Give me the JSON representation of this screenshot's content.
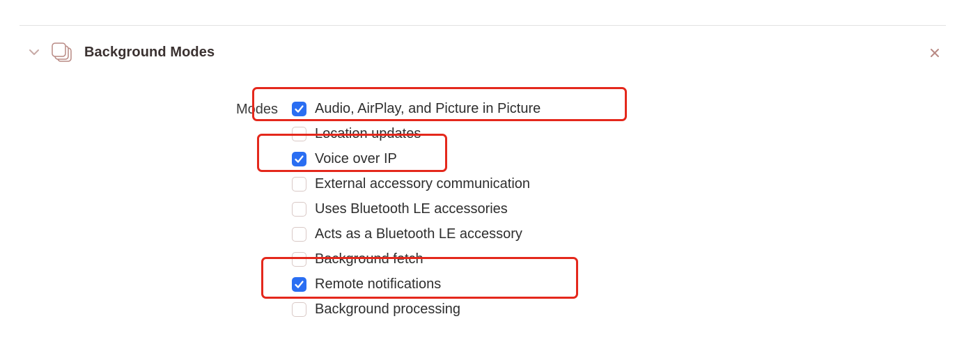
{
  "section": {
    "title": "Background Modes",
    "chevron_icon": "chevron-down-icon",
    "capability_icon": "background-modes-icon",
    "close_icon": "close-icon"
  },
  "modes": {
    "label": "Modes",
    "items": [
      {
        "label": "Audio, AirPlay, and Picture in Picture",
        "checked": true
      },
      {
        "label": "Location updates",
        "checked": false
      },
      {
        "label": "Voice over IP",
        "checked": true
      },
      {
        "label": "External accessory communication",
        "checked": false
      },
      {
        "label": "Uses Bluetooth LE accessories",
        "checked": false
      },
      {
        "label": "Acts as a Bluetooth LE accessory",
        "checked": false
      },
      {
        "label": "Background fetch",
        "checked": false
      },
      {
        "label": "Remote notifications",
        "checked": true
      },
      {
        "label": "Background processing",
        "checked": false
      }
    ]
  },
  "colors": {
    "checkbox_checked": "#2a6ef2",
    "annotation_highlight": "#e4281c"
  }
}
